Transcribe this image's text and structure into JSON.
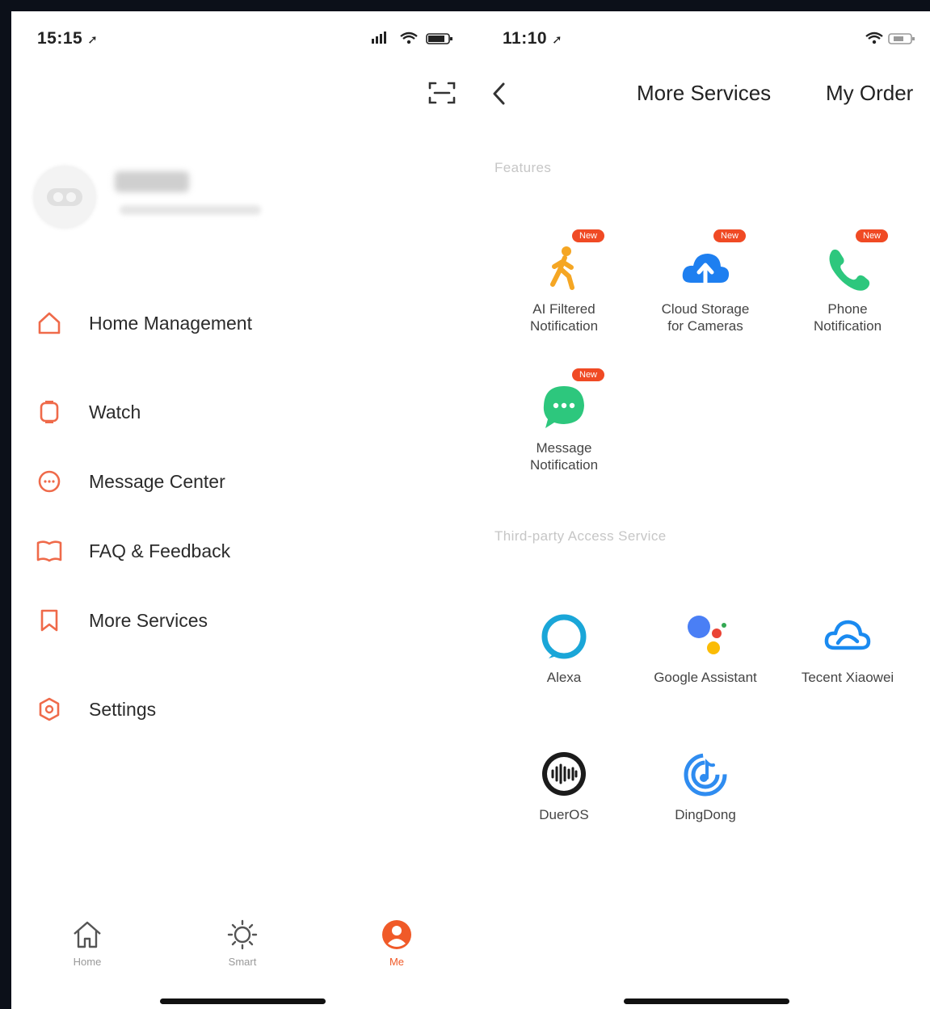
{
  "left_screen": {
    "status_time": "15:15",
    "menu": [
      {
        "label": "Home Management",
        "icon": "home-icon"
      },
      {
        "label": "Watch",
        "icon": "watch-icon"
      },
      {
        "label": "Message Center",
        "icon": "message-icon"
      },
      {
        "label": "FAQ & Feedback",
        "icon": "book-icon"
      },
      {
        "label": "More Services",
        "icon": "bookmark-icon"
      },
      {
        "label": "Settings",
        "icon": "settings-icon"
      }
    ],
    "tabs": [
      {
        "label": "Home",
        "icon": "home-icon",
        "active": false
      },
      {
        "label": "Smart",
        "icon": "sun-icon",
        "active": false
      },
      {
        "label": "Me",
        "icon": "person-icon",
        "active": true
      }
    ]
  },
  "right_screen": {
    "status_time": "11:10",
    "title": "More Services",
    "action": "My Order",
    "sections": {
      "features": "Features",
      "third_party": "Third-party Access Service"
    },
    "features": [
      {
        "label_line1": "AI Filtered",
        "label_line2": "Notification",
        "badge": "New",
        "icon": "walking-person-icon"
      },
      {
        "label_line1": "Cloud Storage",
        "label_line2": "for Cameras",
        "badge": "New",
        "icon": "cloud-upload-icon"
      },
      {
        "label_line1": "Phone",
        "label_line2": "Notification",
        "badge": "New",
        "icon": "phone-icon"
      },
      {
        "label_line1": "Message",
        "label_line2": "Notification",
        "badge": "New",
        "icon": "chat-bubble-icon"
      }
    ],
    "third_party": [
      {
        "label": "Alexa",
        "icon": "alexa-icon"
      },
      {
        "label": "Google Assistant",
        "icon": "google-assistant-icon"
      },
      {
        "label": "Tecent Xiaowei",
        "icon": "cloud-outline-icon"
      },
      {
        "label": "DuerOS",
        "icon": "dueros-icon"
      },
      {
        "label": "DingDong",
        "icon": "dingdong-icon"
      }
    ]
  },
  "colors": {
    "accent": "#f05a28",
    "badge": "#f04a24",
    "menu_icon": "#ef6a4a",
    "frame": "#0c1019"
  }
}
